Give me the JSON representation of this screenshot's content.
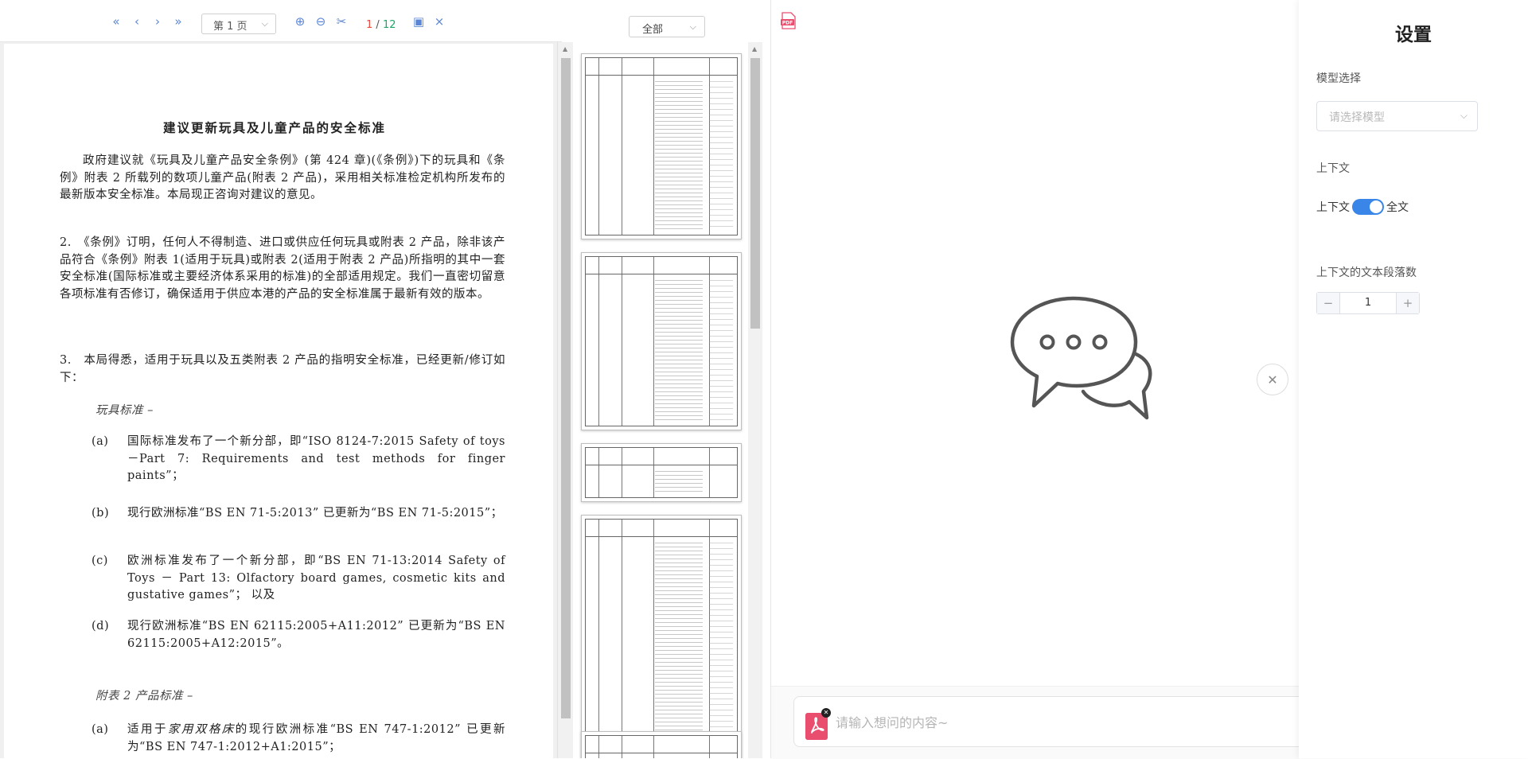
{
  "viewer": {
    "toolbar": {
      "page_select_value": "第 1 页",
      "current_page": "1",
      "separator": "/",
      "total_pages": "12"
    },
    "filter_select_value": "全部"
  },
  "document": {
    "title": "建议更新玩具及儿童产品的安全标准",
    "para1": "政府建议就《玩具及儿童产品安全条例》(第 424 章)(《条例》)下的玩具和《条例》附表 2 所载列的数项儿童产品(附表 2 产品)，采用相关标准检定机构所发布的最新版本安全标准。本局现正咨询对建议的意见。",
    "para2": "2.　《条例》订明，任何人不得制造、进口或供应任何玩具或附表 2 产品，除非该产品符合《条例》附表 1(适用于玩具)或附表 2(适用于附表 2 产品)所指明的其中一套安全标准(国际标准或主要经济体系采用的标准)的全部适用规定。我们一直密切留意各项标准有否修订，确保适用于供应本港的产品的安全标准属于最新有效的版本。",
    "para3": "3.　本局得悉，适用于玩具以及五类附表 2 产品的指明安全标准，已经更新/修订如下：",
    "toy_heading": "玩具标准 –",
    "items": [
      {
        "label": "(a)",
        "text": "国际标准发布了一个新分部，即“ISO 8124-7:2015 Safety of toys－Part 7: Requirements and test methods for finger paints”；"
      },
      {
        "label": "(b)",
        "text": "现行欧洲标准“BS EN 71-5:2013” 已更新为“BS EN 71-5:2015”；"
      },
      {
        "label": "(c)",
        "text": "欧洲标准发布了一个新分部，即“BS EN 71-13:2014 Safety of Toys － Part 13: Olfactory board games, cosmetic kits and gustative games”； 以及"
      },
      {
        "label": "(d)",
        "text": "现行欧洲标准“BS EN 62115:2005+A11:2012” 已更新为“BS EN 62115:2005+A12:2015”。"
      }
    ],
    "schedule_heading": "附表 2 产品标准 –",
    "item_e": {
      "label": "(a)",
      "text_pre": "适用于",
      "text_em": "家用双格床",
      "text_post": "的现行欧洲标准“BS EN 747-1:2012” 已更新为“BS EN 747-1:2012+A1:2015”；"
    }
  },
  "chat": {
    "input_placeholder": "请输入想问的内容~"
  },
  "settings": {
    "title": "设置",
    "model_label": "模型选择",
    "model_placeholder": "请选择模型",
    "context_label": "上下文",
    "switch_left": "上下文",
    "switch_right": "全文",
    "switch_on": true,
    "paragraphs_label": "上下文的文本段落数",
    "paragraphs_value": "1",
    "minus": "−",
    "plus": "+"
  },
  "icons": {
    "first": "«",
    "prev": "‹",
    "next": "›",
    "last": "»",
    "zoom_in": "⊕",
    "zoom_out": "⊖",
    "cut": "✂",
    "image": "▣",
    "close": "×"
  },
  "colors": {
    "accent": "#3a86e8",
    "toolbar_icon": "#5b86d6",
    "page_current": "#e74c3c",
    "page_total": "#1aa864",
    "pdf_red": "#ea4e6f"
  }
}
